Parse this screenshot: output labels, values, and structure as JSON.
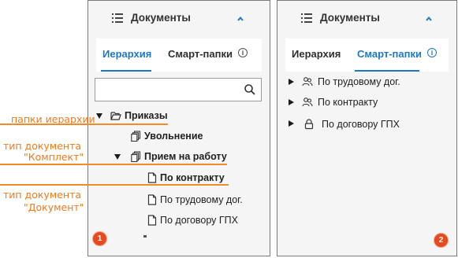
{
  "panel1": {
    "title": "Документы",
    "tabs": [
      {
        "label": "Иерархия",
        "active": true
      },
      {
        "label": "Смарт-папки",
        "active": false
      }
    ],
    "search": {
      "value": "",
      "placeholder": ""
    },
    "tree": [
      {
        "label": "Приказы",
        "icon": "folder-open-icon",
        "expanded": true,
        "bold": true
      },
      {
        "label": "Увольнение",
        "icon": "kit-document-icon",
        "bold": true
      },
      {
        "label": "Прием на работу",
        "icon": "kit-document-icon",
        "expanded": true,
        "bold": true
      },
      {
        "label": "По контракту",
        "icon": "document-icon",
        "bold": true
      },
      {
        "label": "По трудовому дог.",
        "icon": "document-icon",
        "bold": false
      },
      {
        "label": "По договору ГПХ",
        "icon": "document-icon",
        "bold": false
      }
    ],
    "badge": "1"
  },
  "panel2": {
    "title": "Документы",
    "tabs": [
      {
        "label": "Иерархия",
        "active": false
      },
      {
        "label": "Смарт-папки",
        "active": true
      }
    ],
    "smart_folders": [
      {
        "label": "По трудовому дог.",
        "icon": "users-icon"
      },
      {
        "label": "По контракту",
        "icon": "users-icon"
      },
      {
        "label": "По договору ГПХ",
        "icon": "lock-icon"
      }
    ],
    "badge": "2"
  },
  "annotations": {
    "folders": "папки иерархии",
    "kit_line1": "тип документа",
    "kit_line2": "\"Комплект\"",
    "doc_line1": "тип документа",
    "doc_line2": "\"Документ\""
  },
  "colors": {
    "accent": "#1f78c2",
    "annotation": "#f07a1a",
    "badge": "#e74a1f",
    "panel_bg": "#f5f5f5"
  }
}
